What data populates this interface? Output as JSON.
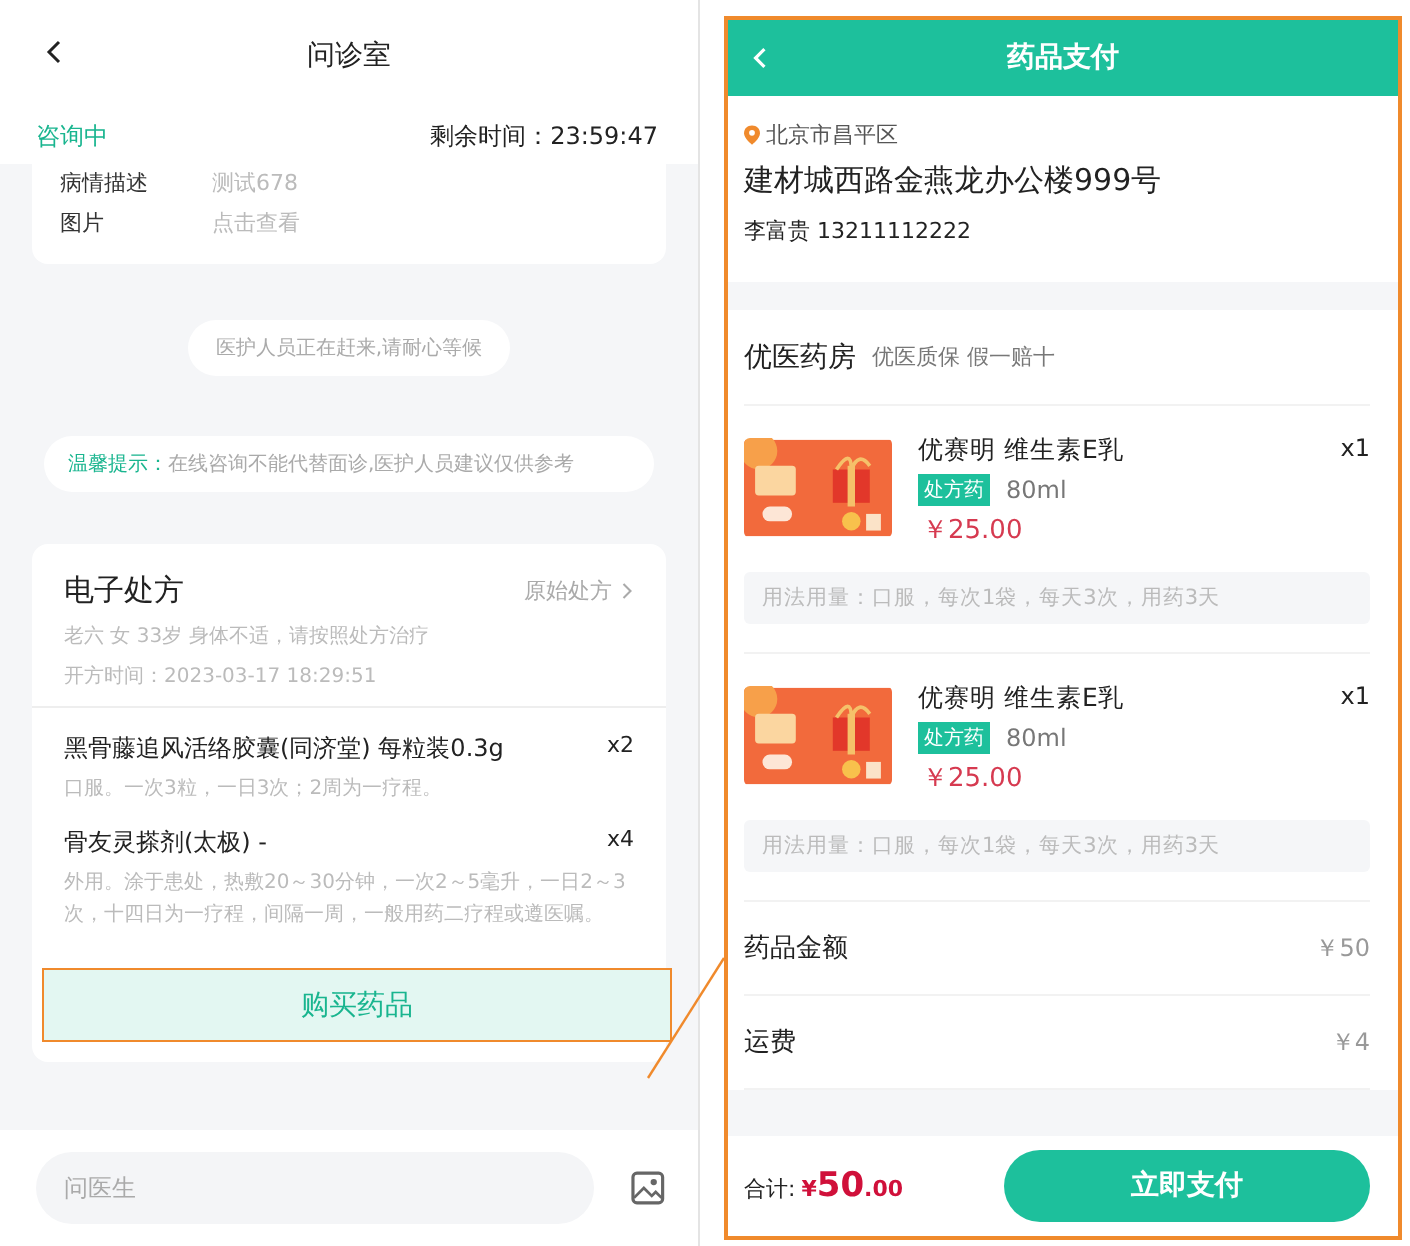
{
  "consult_screen": {
    "header": {
      "title": "问诊室"
    },
    "status": {
      "label": "咨询中",
      "remaining": "剩余时间：23:59:47"
    },
    "info_rows": [
      {
        "label": "病情描述",
        "value": "测试678"
      },
      {
        "label": "图片",
        "value": "点击查看"
      }
    ],
    "notice": "医护人员正在赶来,请耐心等候",
    "tip": {
      "label": "温馨提示：",
      "text": "在线咨询不能代替面诊,医护人员建议仅供参考"
    },
    "prescription": {
      "title": "电子处方",
      "link": "原始处方",
      "patient": "老六 女 33岁 身体不适，请按照处方治疗",
      "time": "开方时间：2023-03-17 18:29:51",
      "drugs": [
        {
          "name": "黑骨藤追风活络胶囊(同济堂) 每粒装0.3g",
          "qty": "x2",
          "usage": "口服。一次3粒，一日3次；2周为一疗程。"
        },
        {
          "name": "骨友灵搽剂(太极) -",
          "qty": "x4",
          "usage": "外用。涂于患处，热敷20～30分钟，一次2～5毫升，一日2～3次，十四日为一疗程，间隔一周，一般用药二疗程或遵医嘱。"
        }
      ]
    },
    "buy_button": "购买药品",
    "input": {
      "placeholder": "问医生"
    }
  },
  "payment_screen": {
    "header": {
      "title": "药品支付"
    },
    "address": {
      "district": "北京市昌平区",
      "street": "建材城西路金燕龙办公楼999号",
      "contact": "李富贵 13211112222"
    },
    "pharmacy": {
      "name": "优医药房",
      "slogan": "优医质保 假一赔十"
    },
    "items": [
      {
        "name": "优赛明 维生素E乳",
        "tag": "处方药",
        "spec": "80ml",
        "price": "￥25.00",
        "qty": "x1",
        "usage": "用法用量：口服，每次1袋，每天3次，用药3天"
      },
      {
        "name": "优赛明 维生素E乳",
        "tag": "处方药",
        "spec": "80ml",
        "price": "￥25.00",
        "qty": "x1",
        "usage": "用法用量：口服，每次1袋，每天3次，用药3天"
      }
    ],
    "summary": [
      {
        "label": "药品金额",
        "value": "￥50"
      },
      {
        "label": "运费",
        "value": "￥4"
      }
    ],
    "footer": {
      "total_label": "合计:",
      "currency": "¥",
      "amount": "50",
      "decimals": ".00",
      "pay_button": "立即支付"
    }
  }
}
